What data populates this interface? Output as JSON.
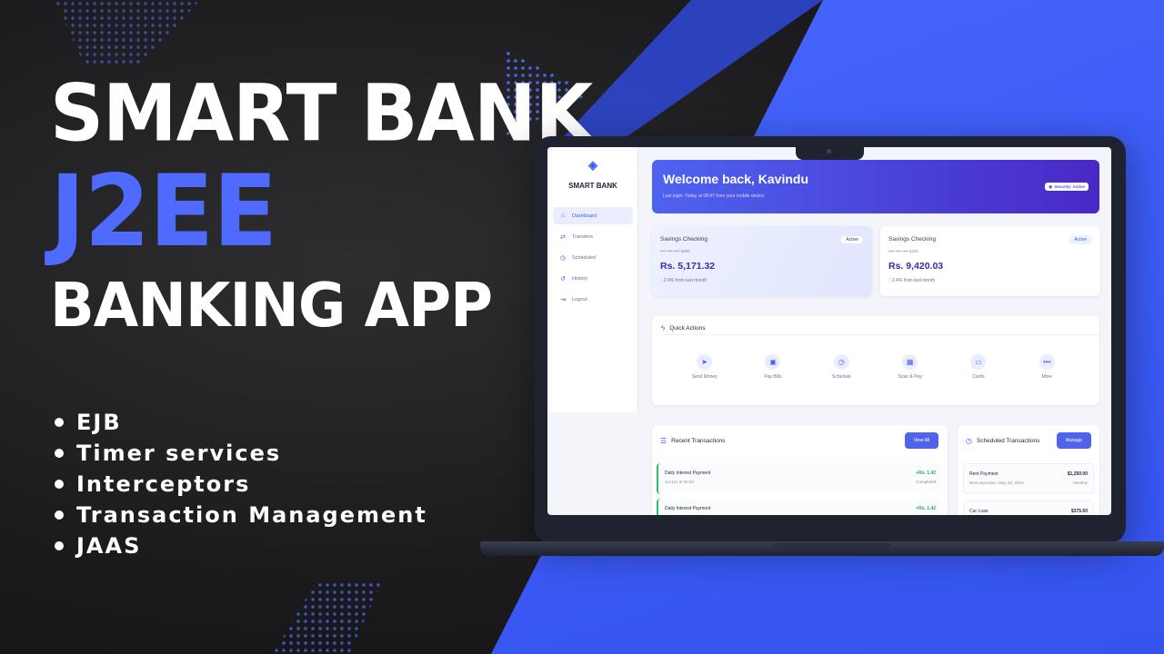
{
  "headline": {
    "line1": "SMART BANK",
    "line2": "J2EE",
    "line3": "BANKING APP"
  },
  "features": [
    "EJB",
    "Timer services",
    "Interceptors",
    "Transaction Management",
    "JAAS"
  ],
  "app": {
    "brand": "SMART BANK",
    "nav": [
      {
        "label": "Dashboard",
        "icon": "home-icon",
        "active": true
      },
      {
        "label": "Transfers",
        "icon": "transfer-icon"
      },
      {
        "label": "Scheduled",
        "icon": "clock-icon"
      },
      {
        "label": "History",
        "icon": "history-icon"
      },
      {
        "label": "Logout",
        "icon": "logout-icon"
      }
    ],
    "welcome": {
      "title": "Welcome back, Kavindu",
      "subtitle": "Last login: Today at 08:47 from your mobile device",
      "badge": "Security: Active"
    },
    "accounts": [
      {
        "name": "Savings Checking",
        "number": "•••• •••• •••• 0866",
        "balance": "Rs. 5,171.32",
        "change": "2.4% from last month",
        "status": "Active"
      },
      {
        "name": "Savings Checking",
        "number": "•••• •••• •••• 5263",
        "balance": "Rs. 9,420.03",
        "change": "2.4% from last month",
        "status": "Active"
      }
    ],
    "quick_actions": {
      "title": "Quick Actions",
      "items": [
        {
          "label": "Send Money",
          "icon": "send-icon"
        },
        {
          "label": "Pay Bills",
          "icon": "bill-icon"
        },
        {
          "label": "Schedule",
          "icon": "clock-icon"
        },
        {
          "label": "Scan & Pay",
          "icon": "qr-icon"
        },
        {
          "label": "Cards",
          "icon": "card-icon"
        },
        {
          "label": "More",
          "icon": "more-icon"
        }
      ]
    },
    "recent": {
      "title": "Recent Transactions",
      "button": "View All",
      "items": [
        {
          "name": "Daily Interest Payment",
          "date": "Jul 24 | at 00:30",
          "amount": "+Rs. 1.42",
          "status": "Completed"
        },
        {
          "name": "Daily Interest Payment",
          "date": "",
          "amount": "+Rs. 1.42",
          "status": ""
        }
      ]
    },
    "scheduled": {
      "title": "Scheduled Transactions",
      "button": "Manage",
      "items": [
        {
          "name": "Rent Payment",
          "next": "Next execution: May 20, 2023",
          "amount": "$1,250.00",
          "freq": "Monthly"
        },
        {
          "name": "Car Loan",
          "next": "",
          "amount": "$375.50",
          "freq": ""
        }
      ]
    }
  },
  "colors": {
    "accent_blue": "#4f6bff",
    "primary": "#3f5df3",
    "positive": "#2aa65b"
  }
}
